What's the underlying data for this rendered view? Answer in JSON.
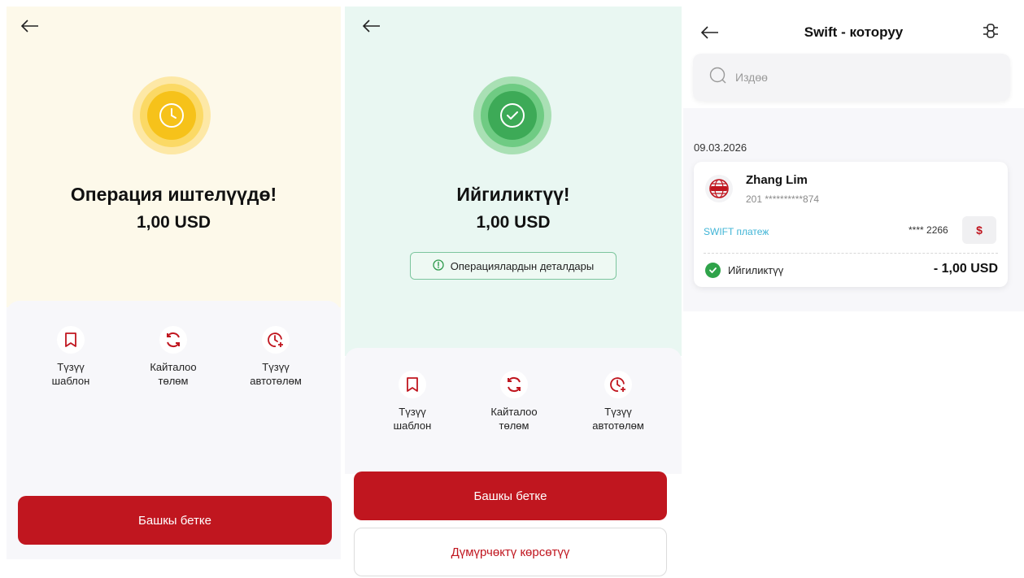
{
  "panel1": {
    "title": "Операция иштелүүдө!",
    "amount": "1,00 USD",
    "actions": [
      {
        "label": "Түзүү\nшаблон",
        "icon": "bookmark-icon"
      },
      {
        "label": "Кайталоо\nтөлөм",
        "icon": "repeat-icon"
      },
      {
        "label": "Түзүү\nавтотөлөм",
        "icon": "clock-plus-icon"
      }
    ],
    "home_button": "Башкы бетке",
    "status_icon": "clock-icon",
    "status_color": "#f6c21a"
  },
  "panel2": {
    "title": "Ийгиликтүү!",
    "amount": "1,00 USD",
    "details_button": "Операциялардын деталдары",
    "actions": [
      {
        "label": "Түзүү\nшаблон",
        "icon": "bookmark-icon"
      },
      {
        "label": "Кайталоо\nтөлөм",
        "icon": "repeat-icon"
      },
      {
        "label": "Түзүү\nавтотөлөм",
        "icon": "clock-plus-icon"
      }
    ],
    "home_button": "Башкы бетке",
    "receipt_button": "Дүмүрчөктү көрсөтүү",
    "status_icon": "check-icon",
    "status_color": "#3daa57"
  },
  "panel3": {
    "title": "Swift - которуу",
    "search_placeholder": "Издөө",
    "date": "09.03.2026",
    "transfer": {
      "name": "Zhang Lim",
      "account": "201 **********874",
      "payment_type": "SWIFT платеж",
      "card_mask": "**** 2266",
      "currency_symbol": "$",
      "status": "Ийгиликтүү",
      "amount": "- 1,00 USD"
    }
  },
  "colors": {
    "accent": "#c0161f",
    "pending_bg": "#fdf9ea",
    "success_bg": "#e9f7f2",
    "link": "#3fb4d6"
  }
}
